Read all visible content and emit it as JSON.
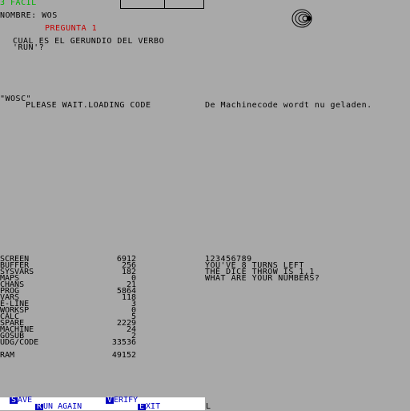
{
  "header": {
    "level": "3 FACIL",
    "name_line": "NOMBRE: WOS",
    "question_title": "PREGUNTA 1"
  },
  "question": {
    "line1": "CUAL ES EL GERUNDIO DEL VERBO",
    "line2": "'RUN'?"
  },
  "loading": {
    "filename": "\"WOSC\"",
    "status": "PLEASE WAIT.LOADING CODE",
    "dutch_message": "De Machinecode wordt nu geladen."
  },
  "sysvars": [
    {
      "name": "SCREEN",
      "value": "6912"
    },
    {
      "name": "BUFFER",
      "value": "256"
    },
    {
      "name": "SYSVARS",
      "value": "182"
    },
    {
      "name": "MAPS",
      "value": "0"
    },
    {
      "name": "CHANS",
      "value": "21"
    },
    {
      "name": "PROG",
      "value": "5864"
    },
    {
      "name": "VARS",
      "value": "118"
    },
    {
      "name": "E-LINE",
      "value": "3"
    },
    {
      "name": "WORKSP",
      "value": "0"
    },
    {
      "name": "CALC",
      "value": "5"
    },
    {
      "name": "SPARE",
      "value": "2229"
    },
    {
      "name": "MACHINE",
      "value": "24"
    },
    {
      "name": "GOSUB",
      "value": "2"
    },
    {
      "name": "UDG/CODE",
      "value": "33536"
    }
  ],
  "ram": {
    "name": "RAM",
    "value": "49152"
  },
  "dice_game": {
    "digits": "123456789",
    "turns": "YOU'VE 8 TURNS LEFT",
    "throw": "THE DICE THROW IS 1,1",
    "prompt": "WHAT ARE YOUR NUMBERS?"
  },
  "menu": {
    "save_key": "S",
    "save_rest": "AVE",
    "verify_key": "V",
    "verify_rest": "ERIFY",
    "run_key": "R",
    "run_rest": "UN AGAIN",
    "exit_key": "E",
    "exit_rest": "XIT"
  },
  "cursor": "L",
  "colors": {
    "background": "#a9a9a9",
    "green_text": "#00b000",
    "red_text": "#c00000",
    "menu_blue": "#0000c0",
    "menu_bg": "#ffffff"
  }
}
